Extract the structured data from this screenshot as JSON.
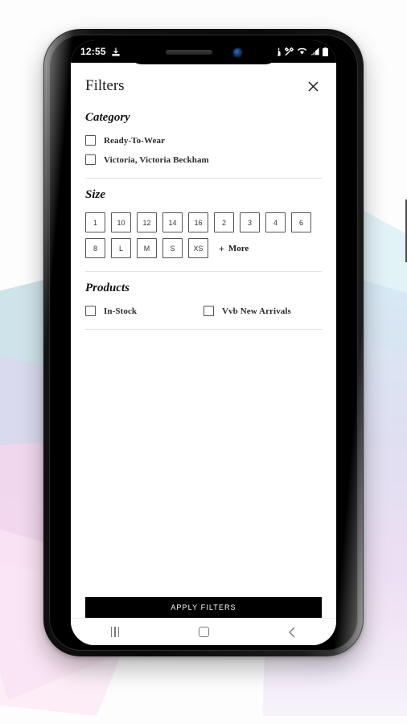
{
  "statusbar": {
    "time": "12:55",
    "download_icon": "download-icon",
    "icons": [
      "person-icon",
      "tools-icon",
      "wifi-icon",
      "signal-icon",
      "battery-icon"
    ]
  },
  "header": {
    "title": "Filters",
    "close_label": "×"
  },
  "sections": {
    "category": {
      "title": "Category",
      "options": [
        {
          "label": "Ready-To-Wear",
          "checked": false
        },
        {
          "label": "Victoria, Victoria Beckham",
          "checked": false
        }
      ]
    },
    "size": {
      "title": "Size",
      "row1": [
        "1",
        "10",
        "12",
        "14",
        "16",
        "2",
        "3",
        "4",
        "6"
      ],
      "row2": [
        "8",
        "L",
        "M",
        "S",
        "XS"
      ],
      "more_label": "More",
      "more_plus": "+"
    },
    "products": {
      "title": "Products",
      "options": [
        {
          "label": "In-Stock",
          "checked": false
        },
        {
          "label": "Vvb New Arrivals",
          "checked": false
        }
      ]
    }
  },
  "footer": {
    "apply_label": "APPLY FILTERS"
  },
  "navbar": {
    "recents": "recents-icon",
    "home": "home-icon",
    "back": "back-icon",
    "back_glyph": "‹"
  },
  "colors": {
    "apply_bg": "#000000",
    "apply_text": "#ffffff",
    "text": "#1b1b1b",
    "divider": "#e3e3e3",
    "box_border": "#555555"
  }
}
